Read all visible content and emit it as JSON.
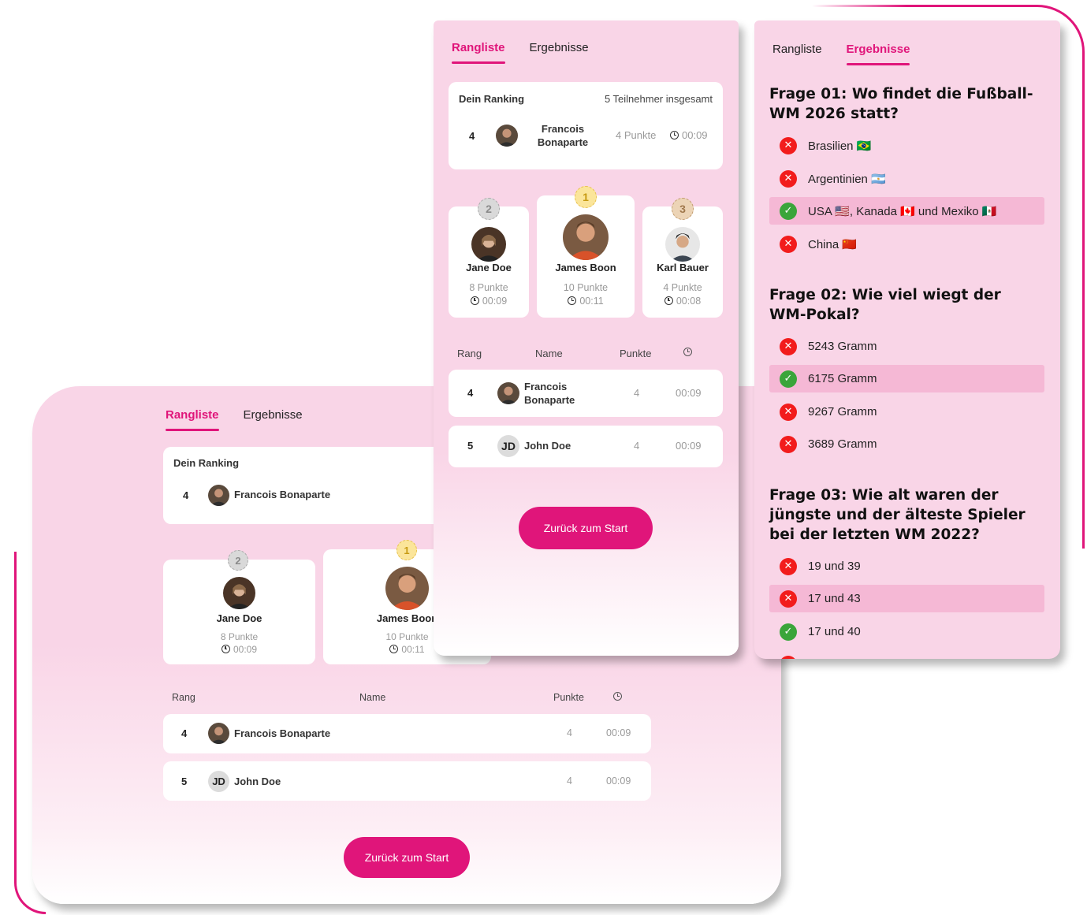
{
  "tabs": {
    "ranking": "Rangliste",
    "results": "Ergebnisse"
  },
  "my_ranking": {
    "label": "Dein Ranking",
    "total": "5 Teilnehmer insgesamt",
    "rank": "4",
    "name": "Francois Bonaparte",
    "name_line1": "Francois",
    "name_line2": "Bonaparte",
    "points": "4 Punkte",
    "time": "00:09"
  },
  "podium": [
    {
      "place": "2",
      "name": "Jane Doe",
      "points": "8 Punkte",
      "time": "00:09"
    },
    {
      "place": "1",
      "name": "James Boon",
      "points": "10 Punkte",
      "time": "00:11"
    },
    {
      "place": "3",
      "name": "Karl Bauer",
      "points": "4 Punkte",
      "time": "00:08"
    }
  ],
  "table": {
    "headers": {
      "rank": "Rang",
      "name": "Name",
      "points": "Punkte"
    },
    "rows": [
      {
        "rank": "4",
        "name": "Francois Bonaparte",
        "name_line1": "Francois",
        "name_line2": "Bonaparte",
        "points": "4",
        "time": "00:09"
      },
      {
        "rank": "5",
        "initials": "JD",
        "name": "John Doe",
        "points": "4",
        "time": "00:09"
      }
    ]
  },
  "back_button": "Zurück zum Start",
  "questions": [
    {
      "title": "Frage 01:  Wo findet die Fußball-WM 2026 statt?",
      "answers": [
        {
          "text": "Brasilien 🇧🇷",
          "status": "wrong",
          "highlight": false
        },
        {
          "text": "Argentinien 🇦🇷",
          "status": "wrong",
          "highlight": false
        },
        {
          "text": "USA 🇺🇸, Kanada 🇨🇦 und Mexiko 🇲🇽",
          "status": "correct",
          "highlight": true
        },
        {
          "text": "China 🇨🇳",
          "status": "wrong",
          "highlight": false
        }
      ]
    },
    {
      "title": "Frage 02:  Wie viel wiegt der WM-Pokal?",
      "answers": [
        {
          "text": "5243 Gramm",
          "status": "wrong",
          "highlight": false
        },
        {
          "text": "6175 Gramm",
          "status": "correct",
          "highlight": true
        },
        {
          "text": "9267 Gramm",
          "status": "wrong",
          "highlight": false
        },
        {
          "text": "3689 Gramm",
          "status": "wrong",
          "highlight": false
        }
      ]
    },
    {
      "title": "Frage 03:  Wie alt waren der jüngste und der älteste Spieler bei der letzten WM 2022?",
      "answers": [
        {
          "text": "19 und 39",
          "status": "wrong",
          "highlight": false
        },
        {
          "text": "17 und 43",
          "status": "wrong",
          "highlight": true
        },
        {
          "text": "17 und 40",
          "status": "correct",
          "highlight": false
        }
      ]
    }
  ],
  "colors": {
    "accent": "#e0157a",
    "panel": "#f9d5e7",
    "wrong": "#f21c1c",
    "correct": "#3aa53a",
    "highlight": "#f5b8d5"
  }
}
